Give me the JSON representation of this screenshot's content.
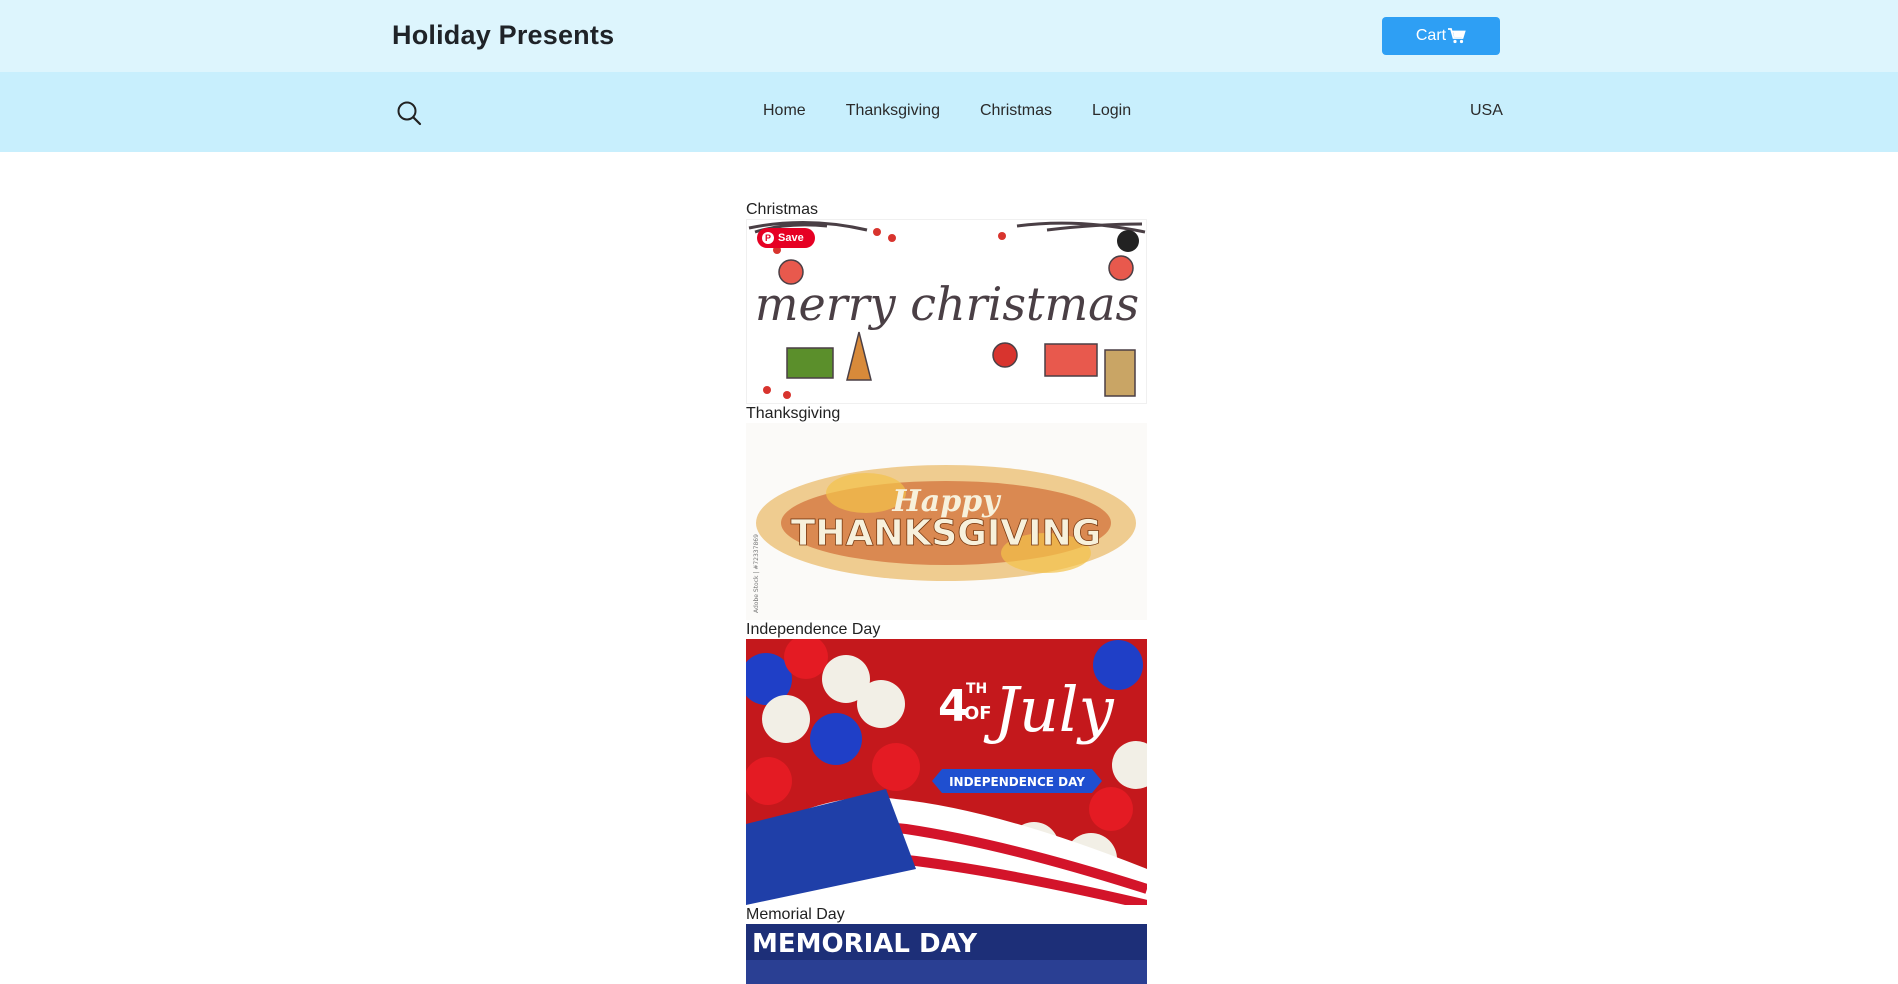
{
  "header": {
    "brand": "Holiday Presents",
    "cart_label": "Cart",
    "cart_icon": "shopping-cart-icon",
    "accent_color": "#2e9ff4",
    "topbar_color": "#ddf5fd",
    "navbar_color": "#c8effd"
  },
  "nav": {
    "search_icon": "search-icon",
    "items": [
      {
        "label": "Home"
      },
      {
        "label": "Thanksgiving"
      },
      {
        "label": "Christmas"
      },
      {
        "label": "Login"
      }
    ],
    "region": "USA"
  },
  "holidays": [
    {
      "caption": "Christmas",
      "banner_text": "merry christmas",
      "pin_save_label": "Save"
    },
    {
      "caption": "Thanksgiving",
      "banner_text_1": "Happy",
      "banner_text_2": "THANKSGIVING",
      "watermark": "Adobe Stock | #72337869"
    },
    {
      "caption": "Independence Day",
      "banner_num": "4",
      "banner_th": "TH",
      "banner_of": "OF",
      "banner_script": "July",
      "ribbon_text": "INDEPENDENCE DAY"
    },
    {
      "caption": "Memorial Day",
      "banner_text": "MEMORIAL DAY"
    }
  ]
}
